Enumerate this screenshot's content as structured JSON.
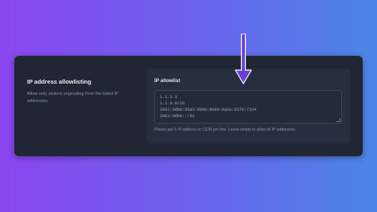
{
  "section": {
    "title": "IP address allowlisting",
    "description": "Allow only visitors originating from the listed IP addresses."
  },
  "allowlist": {
    "label": "IP allowlist",
    "lines": [
      "1.1.1.1",
      "1.1.0.0/16",
      "2001:0db8:85a3:0000:0000:8a2e:0370:7334",
      "2001:0db8::/32"
    ],
    "help_text": "Please put 1 IP address or CIDR per line. Leave empty to allow all IP addresses."
  },
  "colors": {
    "arrow": "#6a3fd8"
  },
  "icons": {
    "arrow": "down-arrow-icon"
  }
}
